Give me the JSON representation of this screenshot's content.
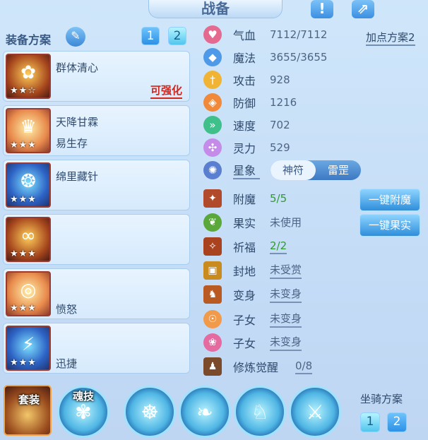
{
  "header": {
    "title": "战备",
    "alert_icon": "exclamation-icon",
    "share_icon": "share-icon"
  },
  "equip_plan": {
    "label": "装备方案",
    "tabs": [
      "1",
      "2"
    ],
    "active_tab": "2"
  },
  "add_point_plan": "加点方案2",
  "equipment": [
    {
      "name": "群体清心",
      "sub": "",
      "stars": "★★☆",
      "upgrade": "可强化"
    },
    {
      "name": "天降甘霖",
      "sub": "易生存",
      "stars": "★★★",
      "upgrade": ""
    },
    {
      "name": "绵里藏针",
      "sub": "",
      "stars": "★★★",
      "upgrade": ""
    },
    {
      "name": "",
      "sub": "",
      "stars": "★★★",
      "upgrade": ""
    },
    {
      "name": "",
      "sub": "愤怒",
      "stars": "★★★",
      "upgrade": ""
    },
    {
      "name": "",
      "sub": "迅捷",
      "stars": "★★★",
      "upgrade": ""
    }
  ],
  "stats": [
    {
      "label": "气血",
      "value": "7112/7112",
      "icon": "heart-icon",
      "color": "#e46a8f"
    },
    {
      "label": "魔法",
      "value": "3655/3655",
      "icon": "mana-icon",
      "color": "#4f9ae8"
    },
    {
      "label": "攻击",
      "value": "928",
      "icon": "attack-icon",
      "color": "#f1b334"
    },
    {
      "label": "防御",
      "value": "1216",
      "icon": "defense-icon",
      "color": "#f08a3a"
    },
    {
      "label": "速度",
      "value": "702",
      "icon": "speed-icon",
      "color": "#3fc08b"
    },
    {
      "label": "灵力",
      "value": "529",
      "icon": "spirit-icon",
      "color": "#c58be8"
    }
  ],
  "star_image": {
    "label": "星象",
    "options": [
      "神符",
      "雷罡"
    ],
    "selected": "神符"
  },
  "features": [
    {
      "label": "附魔",
      "value": "5/5",
      "style": "green"
    },
    {
      "label": "果实",
      "value": "未使用",
      "style": "plain"
    },
    {
      "label": "祈福",
      "value": "2/2",
      "style": "green2"
    },
    {
      "label": "封地",
      "value": "未受赏",
      "style": "link"
    },
    {
      "label": "变身",
      "value": "未变身",
      "style": "link"
    },
    {
      "label": "子女",
      "value": "未变身",
      "style": "link"
    },
    {
      "label": "子女",
      "value": "未变身",
      "style": "link"
    },
    {
      "label": "修炼觉醒",
      "value": "0/8",
      "style": "link"
    }
  ],
  "actions": {
    "enchant": "一键附魔",
    "fruit": "一键果实"
  },
  "bottom": {
    "set_label": "套装",
    "soul_label": "魂技",
    "mount_label": "坐骑方案",
    "mount_tabs": [
      "1",
      "2"
    ]
  }
}
